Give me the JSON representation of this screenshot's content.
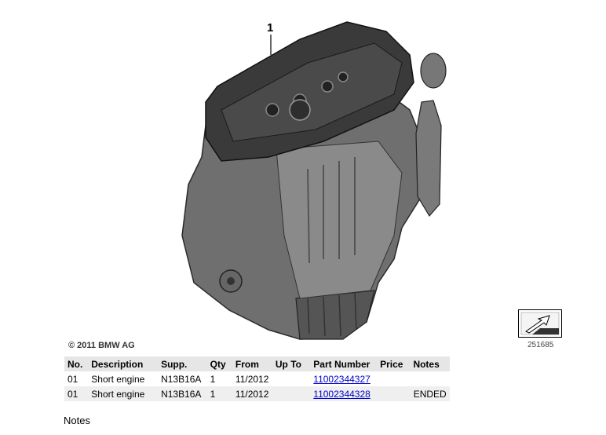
{
  "diagram": {
    "callout": "1",
    "copyright": "© 2011 BMW AG",
    "diagram_number": "251685"
  },
  "table": {
    "headers": [
      "No.",
      "Description",
      "Supp.",
      "Qty",
      "From",
      "Up To",
      "Part Number",
      "Price",
      "Notes"
    ],
    "rows": [
      {
        "no": "01",
        "description": "Short engine",
        "supp": "N13B16A",
        "qty": "1",
        "from": "11/2012",
        "up_to": "",
        "part_number": "11002344327",
        "price": "",
        "notes": ""
      },
      {
        "no": "01",
        "description": "Short engine",
        "supp": "N13B16A",
        "qty": "1",
        "from": "11/2012",
        "up_to": "",
        "part_number": "11002344328",
        "price": "",
        "notes": "ENDED"
      }
    ]
  },
  "notes_heading": "Notes",
  "colors": {
    "link": "#0000cc",
    "header_bg": "#e6e6e6",
    "alt_row": "#efefef"
  }
}
